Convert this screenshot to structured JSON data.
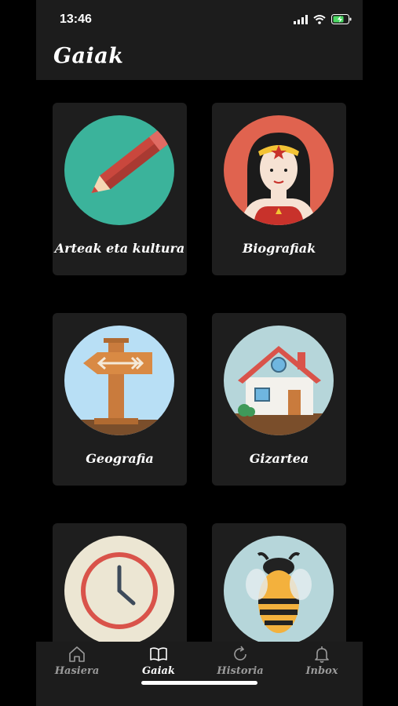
{
  "status_bar": {
    "time": "13:46"
  },
  "header": {
    "title": "Gaiak"
  },
  "categories": [
    {
      "label": "Arteak eta kultura",
      "icon": "pencil-icon",
      "color": "#3bb39b"
    },
    {
      "label": "Biografiak",
      "icon": "wonder-woman-icon",
      "color": "#e0634f"
    },
    {
      "label": "Geografia",
      "icon": "signpost-icon",
      "color": "#b8dff5"
    },
    {
      "label": "Gizartea",
      "icon": "house-icon",
      "color": "#b6d6da"
    },
    {
      "label": "",
      "icon": "clock-icon",
      "color": "#ece6d3"
    },
    {
      "label": "",
      "icon": "bee-icon",
      "color": "#b6d6da"
    }
  ],
  "tabbar": {
    "tabs": [
      {
        "label": "Hasiera",
        "icon": "home-icon",
        "active": false
      },
      {
        "label": "Gaiak",
        "icon": "book-icon",
        "active": true
      },
      {
        "label": "Historia",
        "icon": "refresh-icon",
        "active": false
      },
      {
        "label": "Inbox",
        "icon": "bell-icon",
        "active": false
      }
    ]
  }
}
